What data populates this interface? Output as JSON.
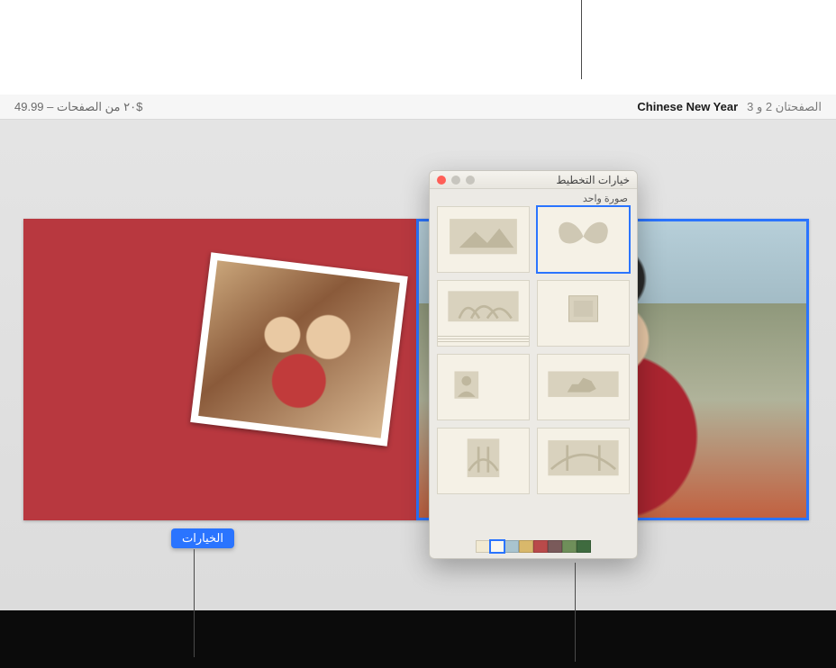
{
  "header": {
    "title": "Chinese New Year",
    "page_range": "الصفحتان 2 و 3",
    "status": "٢٠ من الصفحات – 49.99$"
  },
  "options_button": {
    "label": "الخيارات"
  },
  "popover": {
    "title": "خيارات التخطيط",
    "subtitle": "صورة واحد",
    "selected_index": 0,
    "swatches": [
      "#3f6b3f",
      "#6f8f5a",
      "#7a5a5a",
      "#b94a4a",
      "#d9b86b",
      "#a9c4cf",
      "#f9f7f0",
      "#f2ead2"
    ],
    "swatch_selected_index": 6
  }
}
